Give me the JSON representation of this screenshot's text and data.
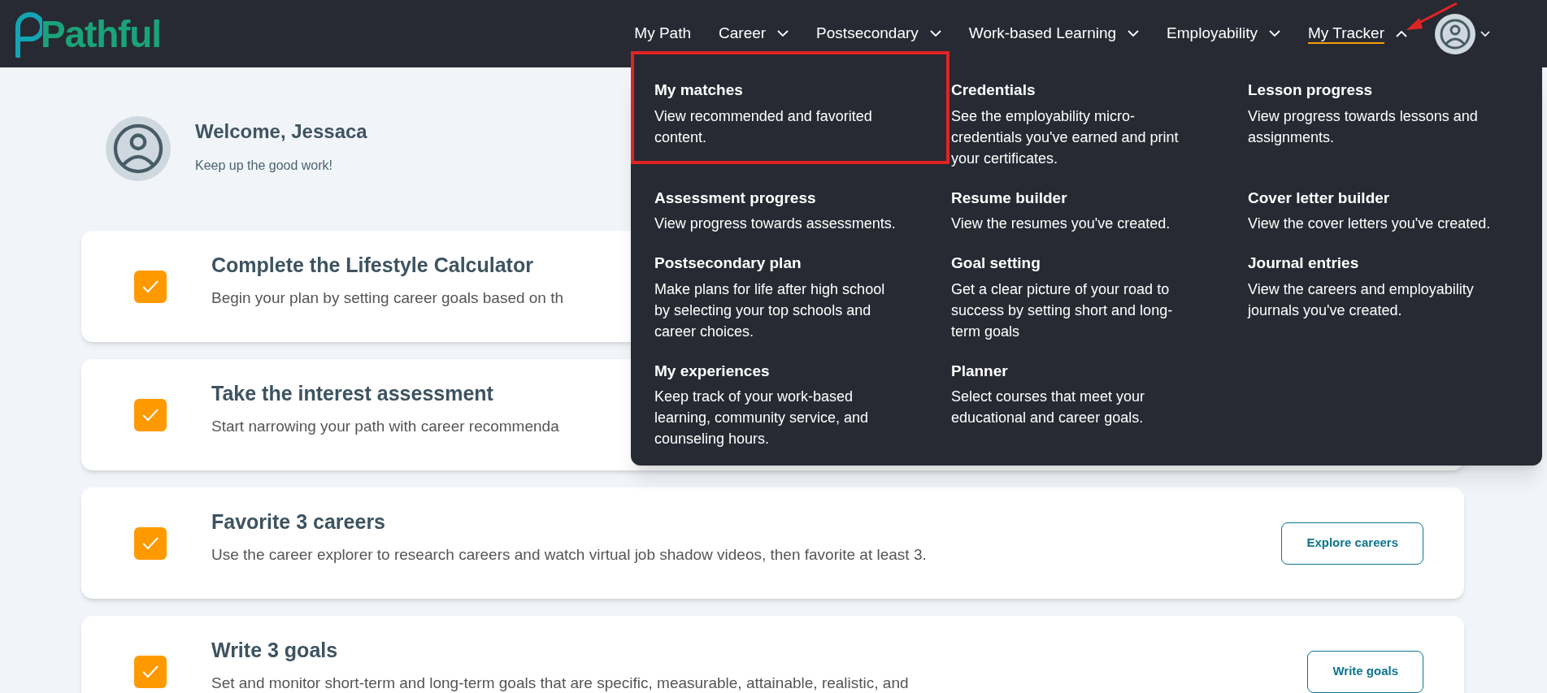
{
  "header": {
    "brand": "Pathful",
    "nav": [
      {
        "label": "My Path",
        "kind": "link",
        "selected": false
      },
      {
        "label": "Career",
        "kind": "menu",
        "selected": false,
        "expanded": false
      },
      {
        "label": "Postsecondary",
        "kind": "menu",
        "selected": false,
        "expanded": false
      },
      {
        "label": "Work-based Learning",
        "kind": "menu",
        "selected": false,
        "expanded": false
      },
      {
        "label": "Employability",
        "kind": "menu",
        "selected": false,
        "expanded": false
      },
      {
        "label": "My Tracker",
        "kind": "menu",
        "selected": true,
        "expanded": true
      }
    ]
  },
  "dropdown": {
    "items": [
      {
        "title": "My matches",
        "description": "View recommended and favorited content.",
        "highlighted": true
      },
      {
        "title": "Credentials",
        "description": "See the employability micro-credentials you've earned and print your certificates.",
        "highlighted": false
      },
      {
        "title": "Lesson progress",
        "description": "View progress towards lessons and assignments.",
        "highlighted": false
      },
      {
        "title": "Assessment progress",
        "description": "View progress towards assessments.",
        "highlighted": false
      },
      {
        "title": "Resume builder",
        "description": "View the resumes you've created.",
        "highlighted": false
      },
      {
        "title": "Cover letter builder",
        "description": "View the cover letters you've created.",
        "highlighted": false
      },
      {
        "title": "Postsecondary plan",
        "description": "Make plans for life after high school by selecting your top schools and career choices.",
        "highlighted": false
      },
      {
        "title": "Goal setting",
        "description": "Get a clear picture of your road to success by setting short and long-term goals",
        "highlighted": false
      },
      {
        "title": "Journal entries",
        "description": "View the careers and employability journals you've created.",
        "highlighted": false
      },
      {
        "title": "My experiences",
        "description": "Keep track of your work-based learning, community service, and counseling hours.",
        "highlighted": false
      },
      {
        "title": "Planner",
        "description": "Select courses that meet your educational and career goals.",
        "highlighted": false
      }
    ]
  },
  "annotations": [
    {
      "kind": "arrow"
    }
  ],
  "welcome": {
    "title": "Welcome, Jessaca",
    "subtitle": "Keep up the good work!"
  },
  "tasks": [
    {
      "title": "Complete the Lifestyle Calculator",
      "description": "Begin your plan by setting career goals based on th",
      "checked": true
    },
    {
      "title": "Take the interest assessment",
      "description": "Start narrowing your path with career recommenda",
      "checked": true
    },
    {
      "title": "Favorite 3 careers",
      "description": "Use the career explorer to research careers and watch virtual job shadow videos, then favorite at least 3.",
      "checked": true,
      "button": "Explore careers"
    },
    {
      "title": "Write 3 goals",
      "description": "Set and monitor short-term and long-term goals that are specific, measurable, attainable, realistic, and",
      "checked": true,
      "button": "Write goals"
    }
  ]
}
